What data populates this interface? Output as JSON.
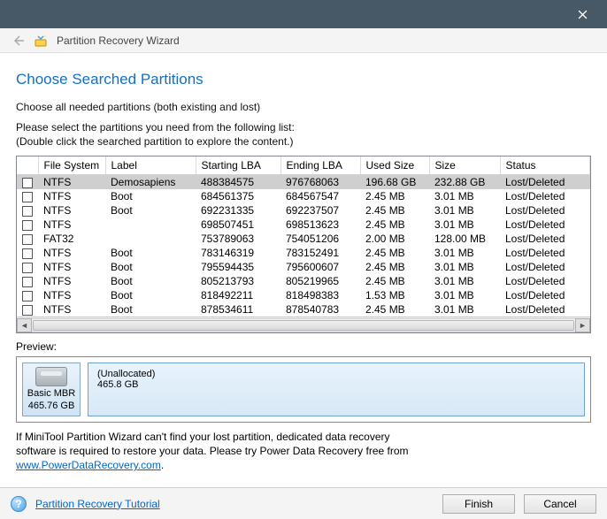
{
  "window": {
    "title": "Partition Recovery Wizard"
  },
  "heading": "Choose Searched Partitions",
  "subtitle": "Choose all needed partitions (both existing and lost)",
  "instructions_line1": "Please select the partitions you need from the following list:",
  "instructions_line2": "(Double click the searched partition to explore the content.)",
  "columns": {
    "fs": "File System",
    "label": "Label",
    "slba": "Starting LBA",
    "elba": "Ending LBA",
    "used": "Used Size",
    "size": "Size",
    "status": "Status"
  },
  "rows": [
    {
      "fs": "NTFS",
      "label": "Demosapiens",
      "slba": "488384575",
      "elba": "976768063",
      "used": "196.68 GB",
      "size": "232.88 GB",
      "status": "Lost/Deleted",
      "selected": true
    },
    {
      "fs": "NTFS",
      "label": "Boot",
      "slba": "684561375",
      "elba": "684567547",
      "used": "2.45 MB",
      "size": "3.01 MB",
      "status": "Lost/Deleted"
    },
    {
      "fs": "NTFS",
      "label": "Boot",
      "slba": "692231335",
      "elba": "692237507",
      "used": "2.45 MB",
      "size": "3.01 MB",
      "status": "Lost/Deleted"
    },
    {
      "fs": "NTFS",
      "label": "",
      "slba": "698507451",
      "elba": "698513623",
      "used": "2.45 MB",
      "size": "3.01 MB",
      "status": "Lost/Deleted"
    },
    {
      "fs": "FAT32",
      "label": "",
      "slba": "753789063",
      "elba": "754051206",
      "used": "2.00 MB",
      "size": "128.00 MB",
      "status": "Lost/Deleted"
    },
    {
      "fs": "NTFS",
      "label": "Boot",
      "slba": "783146319",
      "elba": "783152491",
      "used": "2.45 MB",
      "size": "3.01 MB",
      "status": "Lost/Deleted"
    },
    {
      "fs": "NTFS",
      "label": "Boot",
      "slba": "795594435",
      "elba": "795600607",
      "used": "2.45 MB",
      "size": "3.01 MB",
      "status": "Lost/Deleted"
    },
    {
      "fs": "NTFS",
      "label": "Boot",
      "slba": "805213793",
      "elba": "805219965",
      "used": "2.45 MB",
      "size": "3.01 MB",
      "status": "Lost/Deleted"
    },
    {
      "fs": "NTFS",
      "label": "Boot",
      "slba": "818492211",
      "elba": "818498383",
      "used": "1.53 MB",
      "size": "3.01 MB",
      "status": "Lost/Deleted"
    },
    {
      "fs": "NTFS",
      "label": "Boot",
      "slba": "878534611",
      "elba": "878540783",
      "used": "2.45 MB",
      "size": "3.01 MB",
      "status": "Lost/Deleted"
    }
  ],
  "preview": {
    "label": "Preview:",
    "disk_type": "Basic MBR",
    "disk_size": "465.76 GB",
    "part_label": "(Unallocated)",
    "part_size": "465.8 GB"
  },
  "note_line1": "If MiniTool Partition Wizard can't find your lost partition, dedicated data recovery",
  "note_line2": "software is required to restore your data. Please try Power Data Recovery free from",
  "note_link": "www.PowerDataRecovery.com",
  "note_period": ".",
  "footer": {
    "tutorial": "Partition Recovery Tutorial",
    "finish": "Finish",
    "cancel": "Cancel"
  }
}
